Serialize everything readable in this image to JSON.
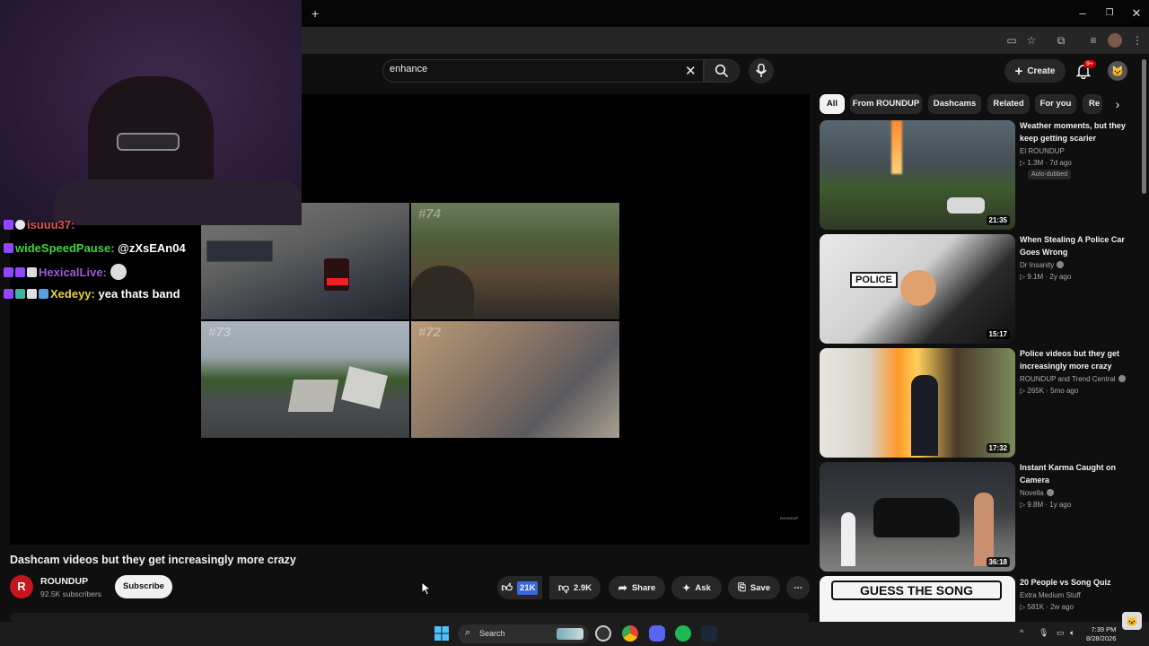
{
  "browser": {
    "new_tab": "+",
    "window_controls": {
      "minimize": "–",
      "maximize": "❐",
      "close": "✕"
    }
  },
  "header": {
    "search_value": "enhance",
    "create_label": "Create",
    "notification_count": "9+"
  },
  "chat": [
    {
      "user": "isuuu37:",
      "text": "",
      "user_color": "#e05555"
    },
    {
      "user": "wideSpeedPause:",
      "text": "@zXsEAn04",
      "user_color": "#3cd43c"
    },
    {
      "user": "HexicalLive:",
      "text": "",
      "user_color": "#9b59d0"
    },
    {
      "user": "Xedeyy:",
      "text": "yea thats band",
      "user_color": "#e8d43a"
    }
  ],
  "video": {
    "clip_numbers": [
      "#74",
      "#73",
      "#72"
    ],
    "watermark": "ROUNDUP",
    "title": "Dashcam videos but they get increasingly more crazy",
    "channel_initial": "R",
    "channel": "ROUNDUP",
    "subscribers": "92.5K subscribers",
    "subscribe_label": "Subscribe",
    "likes": "21K",
    "dislikes": "2.9K",
    "share_label": "Share",
    "ask_label": "Ask",
    "save_label": "Save"
  },
  "chips": [
    "All",
    "From ROUNDUP",
    "Dashcams",
    "Related",
    "For you",
    "Re"
  ],
  "recommendations": [
    {
      "title": "Weather moments, but they keep getting scarier",
      "channel": "El ROUNDUP",
      "meta": "1.3M · 7d ago",
      "badge": "Auto-dubbed",
      "duration": "21:35"
    },
    {
      "title": "When Stealing A Police Car Goes Wrong",
      "channel": "Dr Insanity",
      "meta": "9.1M · 2y ago",
      "duration": "15:17"
    },
    {
      "title": "Police videos but they get increasingly more crazy",
      "channel": "ROUNDUP and Trend Central",
      "meta": "265K · 5mo ago",
      "duration": "17:32"
    },
    {
      "title": "Instant Karma Caught on Camera",
      "channel": "Novella",
      "meta": "9.8M · 1y ago",
      "duration": "36:18"
    },
    {
      "title": "20 People vs Song Quiz",
      "channel": "Extra Medium Stuff",
      "meta": "581K · 2w ago",
      "thumb_text": "GUESS THE SONG"
    }
  ],
  "overlay_text": {
    "police": "POLICE"
  },
  "taskbar": {
    "search_label": "Search",
    "time": "7:39 PM",
    "date": "8/28/2026"
  }
}
